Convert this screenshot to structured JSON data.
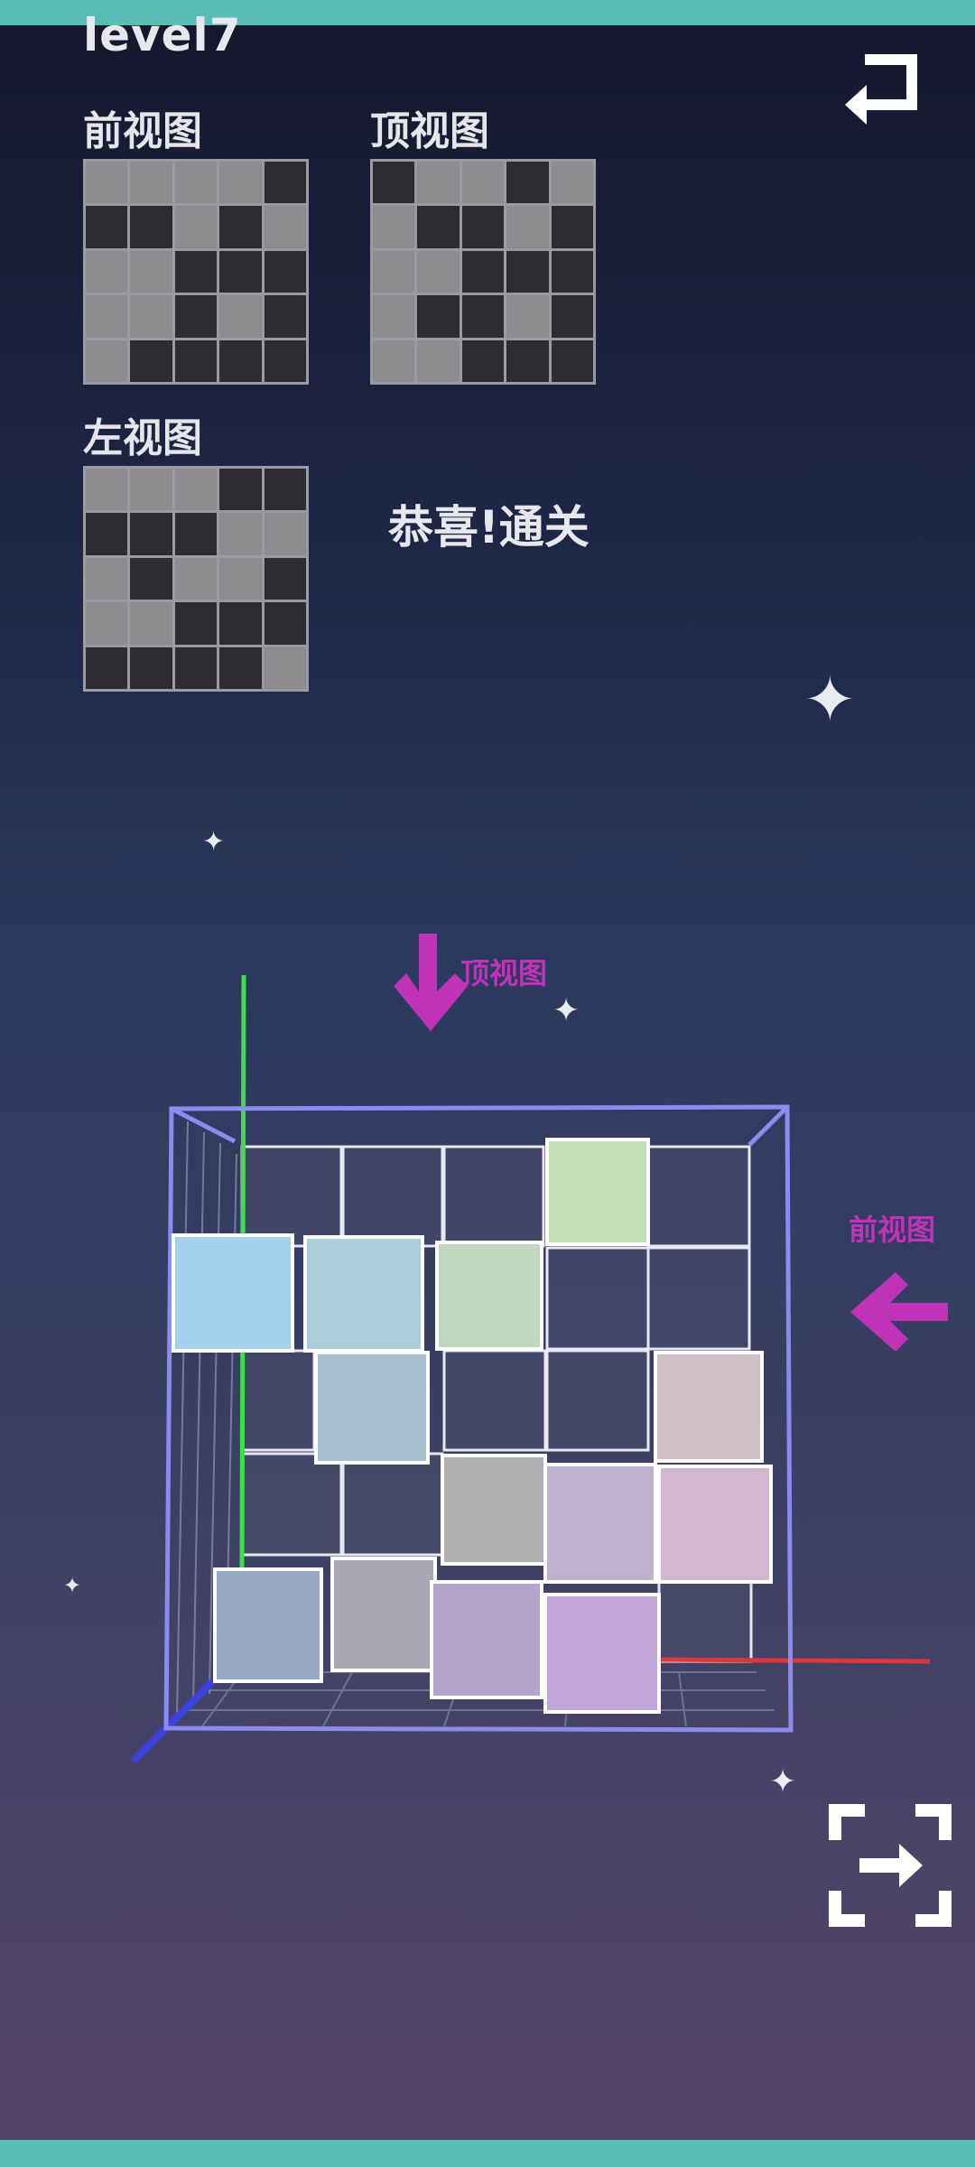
{
  "level_title": "level7",
  "views": {
    "front": {
      "label": "前视图",
      "cells": [
        [
          0,
          0,
          0,
          0,
          1
        ],
        [
          1,
          1,
          0,
          1,
          0
        ],
        [
          0,
          0,
          1,
          1,
          1
        ],
        [
          0,
          0,
          1,
          0,
          1
        ],
        [
          0,
          1,
          1,
          1,
          1
        ]
      ]
    },
    "top": {
      "label": "顶视图",
      "cells": [
        [
          1,
          0,
          0,
          1,
          0
        ],
        [
          0,
          1,
          1,
          0,
          1
        ],
        [
          0,
          0,
          1,
          1,
          1
        ],
        [
          0,
          1,
          1,
          0,
          1
        ],
        [
          0,
          0,
          1,
          1,
          1
        ]
      ]
    },
    "left": {
      "label": "左视图",
      "cells": [
        [
          0,
          0,
          0,
          1,
          1
        ],
        [
          1,
          1,
          1,
          0,
          0
        ],
        [
          0,
          1,
          0,
          0,
          1
        ],
        [
          0,
          0,
          1,
          1,
          1
        ],
        [
          1,
          1,
          1,
          1,
          0
        ]
      ]
    }
  },
  "status_message": "恭喜!通关",
  "scene": {
    "top_view_hint": "顶视图",
    "front_view_hint": "前视图"
  },
  "colors": {
    "light_cell": "#8c8c8f",
    "dark_cell": "#2d2d31",
    "hint_magenta": "#c032b8",
    "accent_teal": "#57bdb6",
    "cube_colors": [
      "#a3d1ea",
      "#a9cdd9",
      "#bfd9c0",
      "#c3e0b8",
      "#a6bfcf",
      "#cfc0c3",
      "#b0b0b3",
      "#c0b2cf",
      "#d3b6d0",
      "#97a8c2",
      "#a8a8b5",
      "#b4a5cc",
      "#c2a6d8"
    ]
  },
  "icons": {
    "back": "return-arrow-icon",
    "exit": "exit-fullscreen-icon",
    "top_arrow": "arrow-down-icon",
    "front_arrow": "arrow-left-icon"
  }
}
